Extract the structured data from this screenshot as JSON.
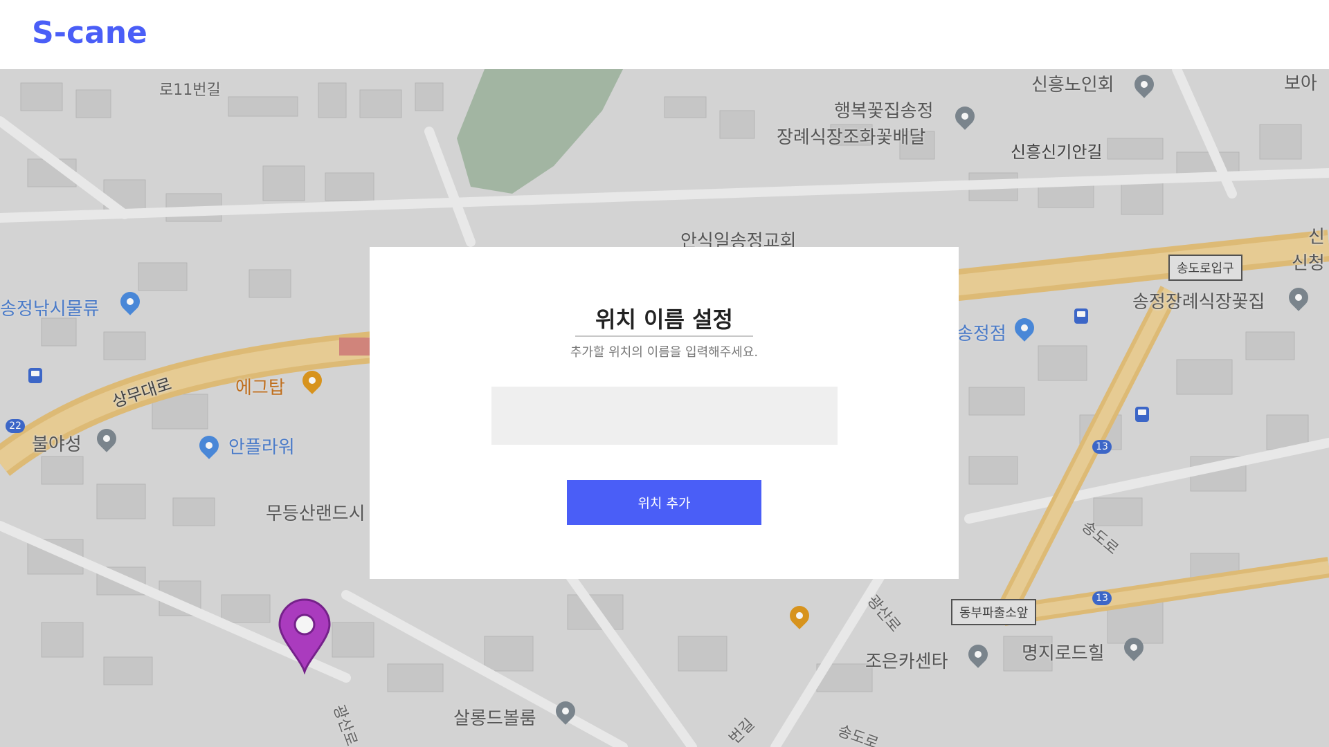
{
  "app": {
    "logo": "S-cane"
  },
  "map": {
    "labels": {
      "l1": "로11번길",
      "l2": "신흥노인회",
      "l3": "행복꽃집송정",
      "l4": "장례식장조화꽃배달",
      "l5": "신흥신기안길",
      "l6": "안식일송정교회",
      "l7": "송정낚시물류",
      "l8": "상무대로",
      "l9": "에그탑",
      "l10": "불야성",
      "l11": "안플라워",
      "l12": "무등산랜드시",
      "l13": "송정장례식장꽃집",
      "l14": "송정점",
      "l15": "송도로",
      "l16": "광산로",
      "l17": "조은카센타",
      "l18": "명지로드힐",
      "l19": "살롱드볼룸",
      "l20": "신청",
      "l21": "보아",
      "l22": "광산로",
      "l23": "번길",
      "l24": "송도로",
      "l25": "신"
    },
    "boxes": {
      "b1": "송도로입구",
      "b2": "동부파출소앞"
    },
    "routes": {
      "r1": "22",
      "r2": "13",
      "r3": "13"
    }
  },
  "dialog": {
    "title": "위치 이름 설정",
    "subtitle": "추가할 위치의 이름을 입력해주세요.",
    "input_value": "",
    "input_placeholder": "",
    "button_label": "위치 추가"
  },
  "colors": {
    "brand": "#4a5ef7",
    "marker": "#b13ec6",
    "road": "#e7c27a"
  }
}
